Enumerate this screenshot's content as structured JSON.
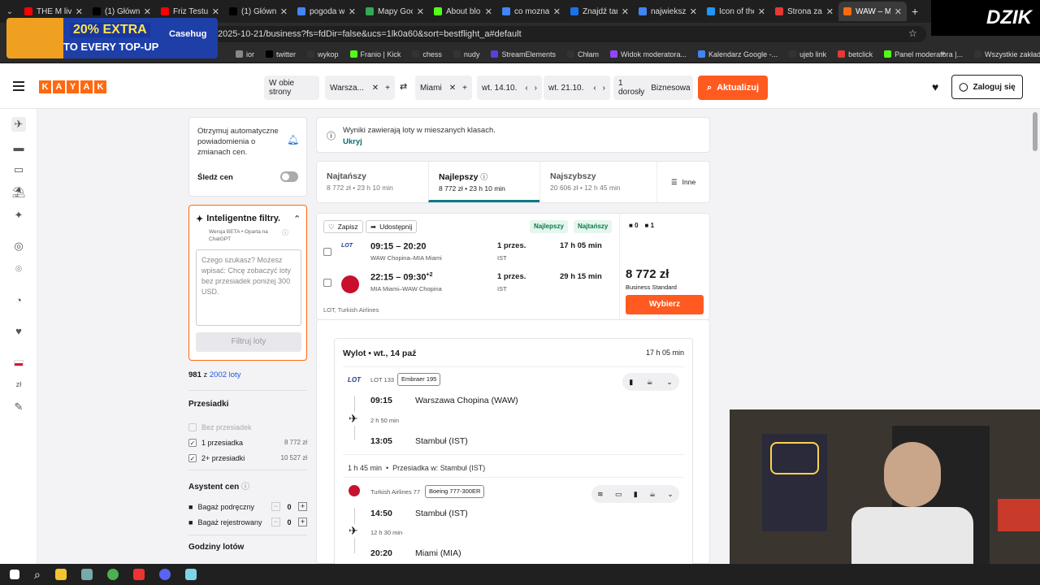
{
  "tabs": [
    {
      "label": "THE M live",
      "color": "#ff0000"
    },
    {
      "label": "(1) Główna",
      "color": "#000000"
    },
    {
      "label": "Friz Testuje",
      "color": "#ff0000"
    },
    {
      "label": "(1) Główna",
      "color": "#000000"
    },
    {
      "label": "pogoda w",
      "color": "#4285f4"
    },
    {
      "label": "Mapy Goo",
      "color": "#34a853"
    },
    {
      "label": "About blo",
      "color": "#53fc18"
    },
    {
      "label": "co mozna",
      "color": "#4285f4"
    },
    {
      "label": "Znajdź tan",
      "color": "#1a73e8"
    },
    {
      "label": "najwieksz",
      "color": "#4285f4"
    },
    {
      "label": "Icon of the",
      "color": "#2196f3"
    },
    {
      "label": "Strona zab",
      "color": "#e53935"
    },
    {
      "label": "WAW – M",
      "color": "#ff690f",
      "active": true
    }
  ],
  "url": "2025-10-21/business?fs=fdDir=false&ucs=1lk0a60&sort=bestflight_a#default",
  "bookmarks": [
    "ior",
    "twitter",
    "wykop",
    "Franio | Kick",
    "chess",
    "nudy",
    "StreamElements",
    "Chłam",
    "Widok moderatora...",
    "Kalendarz Google -...",
    "ujeb link",
    "betclick",
    "Panel moderatora |...",
    "Wszystkie zakładki"
  ],
  "bookmark_colors": [
    "#888",
    "#000",
    "#333",
    "#53fc18",
    "#333",
    "#333",
    "#5b3fd8",
    "#333",
    "#9146ff",
    "#4285f4",
    "#333",
    "#e53935",
    "#53fc18",
    "#333"
  ],
  "ad": {
    "line1": "20% EXTRA",
    "line2": "TO EVERY TOP-UP",
    "brand": "Casehug"
  },
  "overlay_brand": "DZIK",
  "logo_letters": [
    "K",
    "A",
    "Y",
    "A",
    "K"
  ],
  "search": {
    "trip_type": "W obie strony",
    "from": "Warsza...",
    "to": "Miami",
    "depart": "wt. 14.10.",
    "return": "wt. 21.10.",
    "passengers": "1 dorosły",
    "cabin": "Biznesowa",
    "update": "Aktualizuj",
    "login": "Zaloguj się"
  },
  "alert": {
    "text": "Otrzymuj automatyczne powiadomienia o zmianach cen.",
    "track": "Śledź cen"
  },
  "smart": {
    "title": "Inteligentne filtry.",
    "sub": "Wersja BETA • Oparta na ChatGPT",
    "placeholder": "Czego szukasz? Możesz wpisać: Chcę zobaczyć loty bez przesiadek poniżej 300 USD.",
    "button": "Filtruj loty"
  },
  "count": {
    "shown": "981",
    "of": " z ",
    "total": "2002 loty"
  },
  "stops": {
    "title": "Przesiadki",
    "items": [
      {
        "label": "Bez przesiadek",
        "price": "",
        "checked": false,
        "disabled": true
      },
      {
        "label": "1 przesiadka",
        "price": "8 772 zł",
        "checked": true
      },
      {
        "label": "2+ przesiadki",
        "price": "10 527 zł",
        "checked": true
      }
    ]
  },
  "assistant": {
    "title": "Asystent cen",
    "bags": [
      {
        "label": "Bagaż podręczny",
        "value": "0"
      },
      {
        "label": "Bagaż rejestrowany",
        "value": "0"
      }
    ]
  },
  "hours_title": "Godziny lotów",
  "notice": {
    "text": "Wyniki zawierają loty w mieszanych klasach.",
    "link": "Ukryj"
  },
  "sort_tabs": [
    {
      "title": "Najtańszy",
      "sub": "8 772 zł • 23 h 10 min"
    },
    {
      "title": "Najlepszy",
      "sub": "8 772 zł • 23 h 10 min",
      "active": true
    },
    {
      "title": "Najszybszy",
      "sub": "20 606 zł • 12 h 45 min"
    }
  ],
  "sort_more": "Inne",
  "result": {
    "save": "Zapisz",
    "share": "Udostępnij",
    "badges": [
      "Najlepszy",
      "Najtańszy"
    ],
    "bag_counts": [
      "0",
      "1"
    ],
    "legs": [
      {
        "times": "09:15 – 20:20",
        "plus": "",
        "route": "WAW Chopina–MIA Miami",
        "stops": "1 przes.",
        "via": "IST",
        "duration": "17 h 05 min",
        "logo": "LOT"
      },
      {
        "times": "22:15 – 09:30",
        "plus": "+2",
        "route": "MIA Miami–WAW Chopina",
        "stops": "1 przes.",
        "via": "IST",
        "duration": "29 h 15 min",
        "logo": "TK"
      }
    ],
    "airlines": "LOT, Turkish Airlines",
    "price": "8 772 zł",
    "fare": "Business Standard",
    "select": "Wybierz"
  },
  "detail": {
    "title": "Wylot • wt., 14 paź",
    "total": "17 h 05 min",
    "seg1": {
      "carrier": "LOT 133",
      "aircraft": "Embraer 195",
      "dep_time": "09:15",
      "dep": "Warszawa Chopina (WAW)",
      "dur": "2 h 50 min",
      "arr_time": "13:05",
      "arr": "Stambuł (IST)"
    },
    "layover": "1 h 45 min  •  Przesiadka w: Stambuł (IST)",
    "seg2": {
      "carrier": "Turkish Airlines 77",
      "aircraft": "Boeing 777-300ER",
      "dep_time": "14:50",
      "dep": "Stambuł (IST)",
      "dur": "12 h 30 min",
      "arr_time": "20:20",
      "arr": "Miami (MIA)"
    }
  },
  "rail_currency": "zł"
}
